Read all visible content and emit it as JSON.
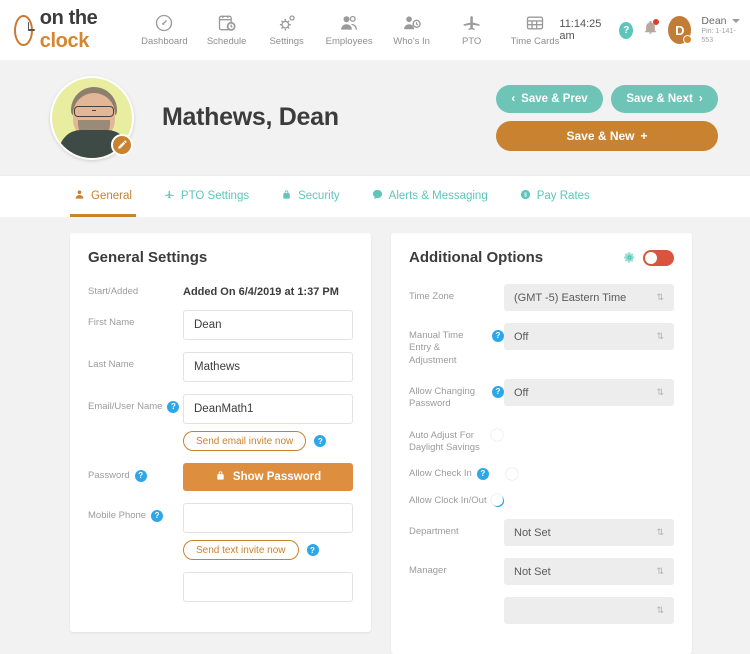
{
  "brand": {
    "name_part1": "on the ",
    "name_part2": "clock",
    "logo_icon": "clock-icon",
    "accent_color": "#d4872f",
    "teal_color": "#6ec4b7"
  },
  "topnav": {
    "items": [
      {
        "label": "Dashboard",
        "icon": "speedometer-icon"
      },
      {
        "label": "Schedule",
        "icon": "calendar-clock-icon"
      },
      {
        "label": "Settings",
        "icon": "gears-icon"
      },
      {
        "label": "Employees",
        "icon": "people-icon"
      },
      {
        "label": "Who's In",
        "icon": "person-clock-icon"
      },
      {
        "label": "PTO",
        "icon": "airplane-icon"
      },
      {
        "label": "Time Cards",
        "icon": "grid-card-icon"
      }
    ],
    "clock_time": "11:14:25 am",
    "help_label": "?",
    "bell_icon": "bell-icon",
    "user": {
      "initial": "D",
      "name": "Dean",
      "pin": "Pin: 1-141-553"
    }
  },
  "profile": {
    "name": "Mathews, Dean",
    "edit_icon": "pencil-icon",
    "actions": {
      "save_prev": "Save & Prev",
      "save_next": "Save & Next",
      "save_new": "Save & New",
      "save_new_plus": "+",
      "prev_arrow": "‹",
      "next_arrow": "›"
    }
  },
  "tabs": [
    {
      "label": "General",
      "icon": "person-icon",
      "active": true
    },
    {
      "label": "PTO Settings",
      "icon": "airplane-icon",
      "active": false
    },
    {
      "label": "Security",
      "icon": "lock-icon",
      "active": false
    },
    {
      "label": "Alerts & Messaging",
      "icon": "chat-bubble-icon",
      "active": false
    },
    {
      "label": "Pay Rates",
      "icon": "dollar-coin-icon",
      "active": false
    }
  ],
  "general_settings": {
    "title": "General Settings",
    "start_added_label": "Start/Added",
    "start_added_value": "Added On 6/4/2019 at 1:37 PM",
    "first_name_label": "First Name",
    "first_name_value": "Dean",
    "last_name_label": "Last Name",
    "last_name_value": "Mathews",
    "email_label": "Email/User Name",
    "email_value": "DeanMath1",
    "send_email_invite": "Send email invite now",
    "password_label": "Password",
    "show_password_button": "Show Password",
    "password_lock_icon": "lock-icon",
    "mobile_phone_label": "Mobile Phone",
    "mobile_phone_value": "",
    "send_text_invite": "Send text invite now",
    "help_glyph": "?"
  },
  "additional_options": {
    "title": "Additional Options",
    "gear_icon": "gear-icon",
    "master_toggle_state": "off",
    "master_toggle_color": "#d9543c",
    "rows": [
      {
        "label": "Time Zone",
        "type": "select",
        "value": "(GMT -5) Eastern Time",
        "help": false
      },
      {
        "label": "Manual Time Entry & Adjustment",
        "type": "select",
        "value": "Off",
        "help": true
      },
      {
        "label": "Allow Changing Password",
        "type": "select",
        "value": "Off",
        "help": true
      },
      {
        "label": "Auto Adjust For Daylight Savings",
        "type": "toggle",
        "value": "on",
        "help": false
      },
      {
        "label": "Allow Check In",
        "type": "toggle",
        "value": "off",
        "help": true
      },
      {
        "label": "Allow Clock In/Out",
        "type": "toggle",
        "value": "on",
        "help": true
      },
      {
        "label": "Department",
        "type": "select",
        "value": "Not Set",
        "help": false
      },
      {
        "label": "Manager",
        "type": "select",
        "value": "Not Set",
        "help": false
      }
    ]
  }
}
